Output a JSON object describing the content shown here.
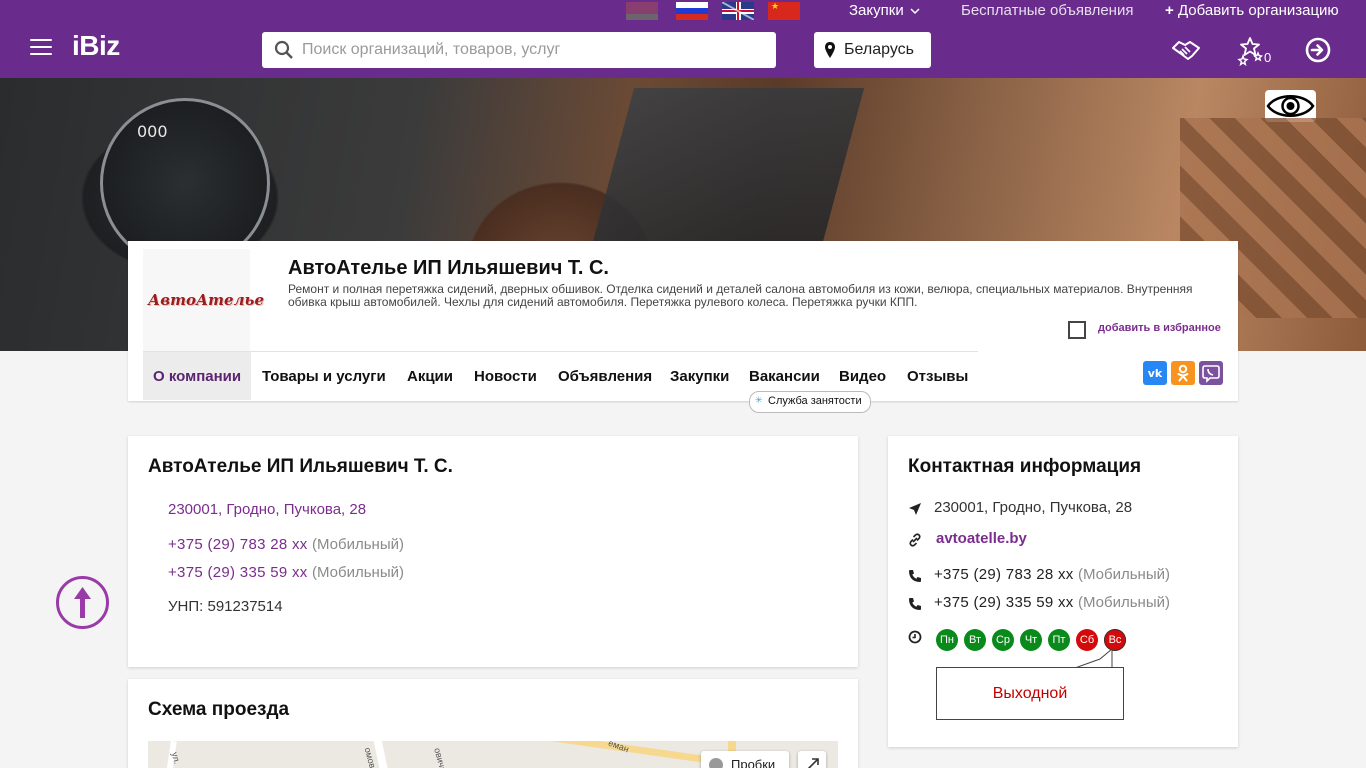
{
  "topbar": {
    "flags": [
      "by-flag",
      "ru-flag",
      "gb-flag",
      "cn-flag"
    ],
    "menu": {
      "procurements": "Закупки",
      "free_ads": "Бесплатные объявления",
      "add_org": "Добавить организацию"
    }
  },
  "header": {
    "logo": "iBiz",
    "search_placeholder": "Поиск организаций, товаров, услуг",
    "region": "Беларусь",
    "favorites_count": "0",
    "icons": [
      "handshake-icon",
      "stars-icon",
      "login-icon"
    ]
  },
  "banner": {
    "gauge_text": "000",
    "eye_button_icon": "eye-icon"
  },
  "company": {
    "logo_text": "АвтоАтелье",
    "name": "АвтоАтелье ИП Ильяшевич Т. С.",
    "description": "Ремонт и полная перетяжка сидений, дверных обшивок. Отделка сидений и деталей салона автомобиля из кожи, велюра, специальных материалов. Внутренняя обивка крыш автомобилей. Чехлы для сидений автомобиля. Перетяжка рулевого колеса. Перетяжка ручки КПП.",
    "favorite_label": "добавить в избранное",
    "tabs": [
      "О компании",
      "Товары и услуги",
      "Акции",
      "Новости",
      "Объявления",
      "Закупки",
      "Вакансии",
      "Видео",
      "Отзывы"
    ],
    "employment_badge": "Служба занятости",
    "social": {
      "vk": "VK",
      "ok": "OK",
      "viber": "Viber"
    }
  },
  "about": {
    "title": "АвтоАтелье ИП Ильяшевич Т. С.",
    "address": "230001, Гродно, Пучкова, 28",
    "phones": [
      {
        "number": "+375 (29) 783 28 хх",
        "type": "(Мобильный)"
      },
      {
        "number": "+375 (29) 335 59 хх",
        "type": "(Мобильный)"
      }
    ],
    "unp": "УНП: 591237514"
  },
  "map_card": {
    "title": "Схема проезда",
    "traffic_label": "Пробки",
    "street_labels": [
      "ул.",
      "омовс",
      "овича",
      "еман"
    ]
  },
  "contact": {
    "title": "Контактная информация",
    "address": "230001, Гродно, Пучкова, 28",
    "website": "avtoatelle.by",
    "phones": [
      {
        "number": "+375 (29) 783 28 хх",
        "type": "(Мобильный)"
      },
      {
        "number": "+375 (29) 335 59 хх",
        "type": "(Мобильный)"
      }
    ],
    "days": [
      {
        "label": "Пн",
        "status": "work"
      },
      {
        "label": "Вт",
        "status": "work"
      },
      {
        "label": "Ср",
        "status": "work"
      },
      {
        "label": "Чт",
        "status": "work"
      },
      {
        "label": "Пт",
        "status": "work"
      },
      {
        "label": "Сб",
        "status": "off"
      },
      {
        "label": "Вс",
        "status": "off"
      }
    ],
    "today_status": "Выходной"
  },
  "colors": {
    "brand": "#6a2c8c",
    "link": "#7b2d8e",
    "work_day": "#0b8a1c",
    "off_day": "#d40a0a"
  }
}
